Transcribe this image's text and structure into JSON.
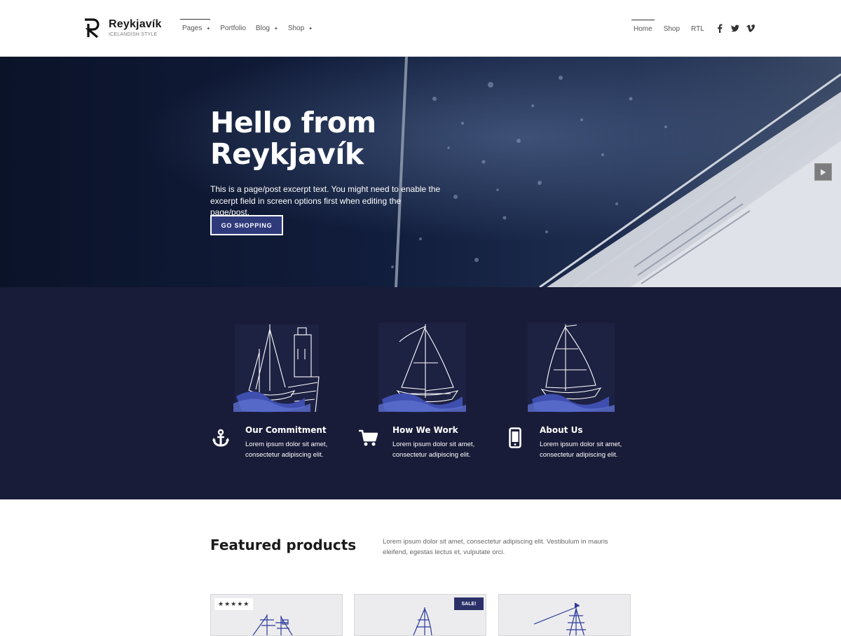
{
  "brand": {
    "name": "Reykjavík",
    "tagline": "ICELANDISH STYLE"
  },
  "nav_main": [
    {
      "label": "Pages",
      "has_caret": true,
      "active": true
    },
    {
      "label": "Portfolio",
      "has_caret": false,
      "active": false
    },
    {
      "label": "Blog",
      "has_caret": true,
      "active": false
    },
    {
      "label": "Shop",
      "has_caret": true,
      "active": false
    }
  ],
  "nav_secondary": [
    {
      "label": "Home",
      "active": true
    },
    {
      "label": "Shop",
      "active": false
    },
    {
      "label": "RTL",
      "active": false
    }
  ],
  "social": [
    "facebook-icon",
    "twitter-icon",
    "vimeo-icon"
  ],
  "hero": {
    "title": "Hello from Reykjavík",
    "text": "This is a page/post excerpt text. You might need to enable the excerpt field in screen options first when editing the page/post.",
    "button": "GO SHOPPING"
  },
  "features": [
    {
      "icon": "anchor-icon",
      "title": "Our Commitment",
      "text": "Lorem ipsum dolor sit amet, consectetur adipiscing elit."
    },
    {
      "icon": "cart-icon",
      "title": "How We Work",
      "text": "Lorem ipsum dolor sit amet, consectetur adipiscing elit."
    },
    {
      "icon": "mobile-icon",
      "title": "About Us",
      "text": "Lorem ipsum dolor sit amet, consectetur adipiscing elit."
    }
  ],
  "products": {
    "heading": "Featured products",
    "description": "Lorem ipsum dolor sit amet, consectetur adipiscing elit. Vestibulum in mauris eleifend, egestas lectus et, vulputate orci.",
    "cards": [
      {
        "rating_stars": 5,
        "badge": ""
      },
      {
        "rating_stars": 0,
        "badge": "SALE!"
      },
      {
        "rating_stars": 0,
        "badge": ""
      }
    ]
  },
  "colors": {
    "accent": "#2f3a7a",
    "features_bg": "#191c38",
    "wave_blue": "#3f4fb0"
  }
}
